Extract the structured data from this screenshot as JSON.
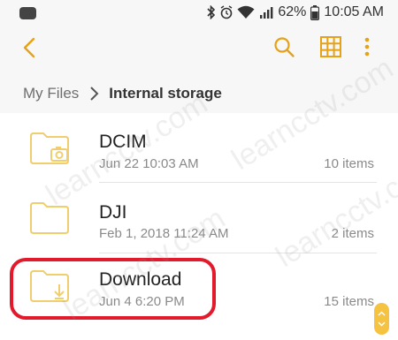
{
  "status_bar": {
    "battery": "62%",
    "time": "10:05 AM",
    "icons": [
      "bluetooth-icon",
      "alarm-icon",
      "wifi-icon",
      "signal-icon",
      "battery-icon"
    ]
  },
  "app_bar": {
    "icons": [
      "back-icon",
      "search-icon",
      "grid-view-icon",
      "more-options-icon"
    ],
    "accent_color": "#e6a117"
  },
  "breadcrumb": {
    "root": "My Files",
    "current": "Internal storage"
  },
  "files": [
    {
      "name": "DCIM",
      "date": "Jun 22 10:03 AM",
      "count": "10 items",
      "icon": "camera-folder-icon"
    },
    {
      "name": "DJI",
      "date": "Feb 1, 2018 11:24 AM",
      "count": "2 items",
      "icon": "folder-icon"
    },
    {
      "name": "Download",
      "date": "Jun 4 6:20 PM",
      "count": "15 items",
      "icon": "download-folder-icon"
    }
  ],
  "watermark": "learncctv.com",
  "colors": {
    "folder": "#f0ce6d",
    "highlight": "#e21a2c",
    "scroll_handle": "#f5c242"
  }
}
